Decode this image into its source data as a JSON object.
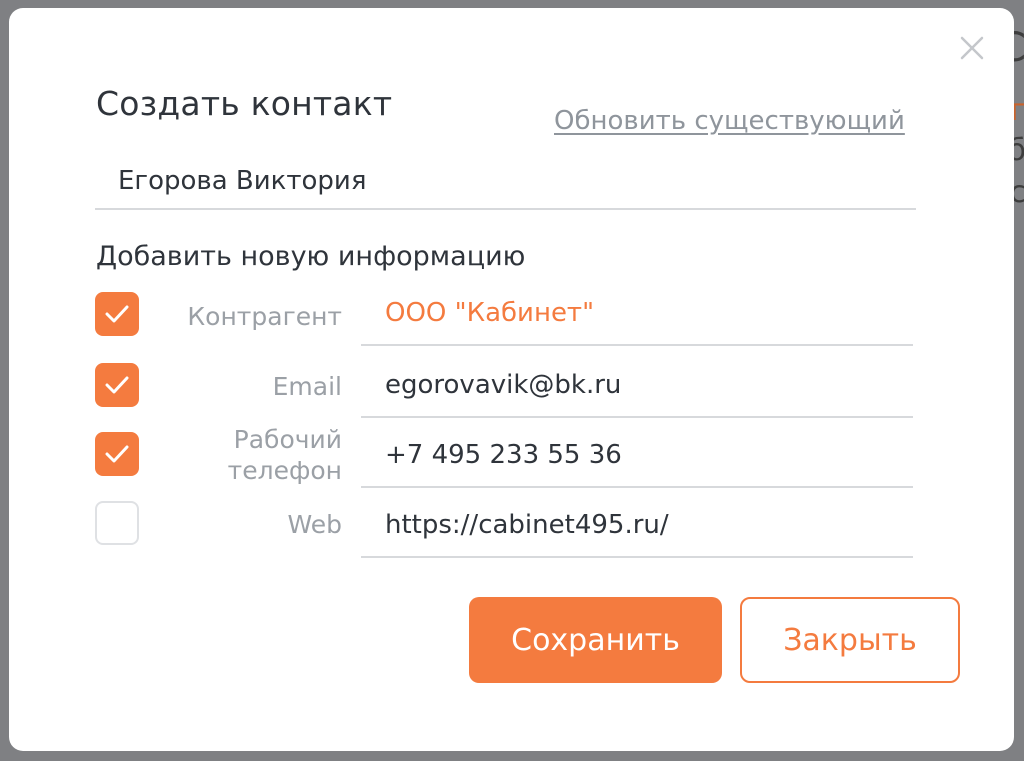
{
  "dialog": {
    "title": "Создать контакт",
    "update_link": "Обновить существующий",
    "contact_name": "Егорова Виктория",
    "section_title": "Добавить новую информацию",
    "fields": [
      {
        "label": "Контрагент",
        "value": "ООО \"Кабинет\"",
        "checked": true
      },
      {
        "label": "Email",
        "value": "egorovavik@bk.ru",
        "checked": true
      },
      {
        "label_line1": "Рабочий",
        "label_line2": "телефон",
        "value": "+7 495 233 55 36",
        "checked": true
      },
      {
        "label": "Web",
        "value": "https://cabinet495.ru/",
        "checked": false
      }
    ],
    "save_label": "Сохранить",
    "close_label": "Закрыть"
  },
  "background_peek": [
    "С",
    "г",
    "б",
    "с"
  ],
  "icons": {
    "close": "close-icon",
    "check": "checkmark-icon"
  },
  "colors": {
    "accent": "#f47b3f",
    "text": "#2f343b",
    "muted": "#9ba0a6",
    "border": "#d7d9dc",
    "overlay": "#7f8083"
  }
}
